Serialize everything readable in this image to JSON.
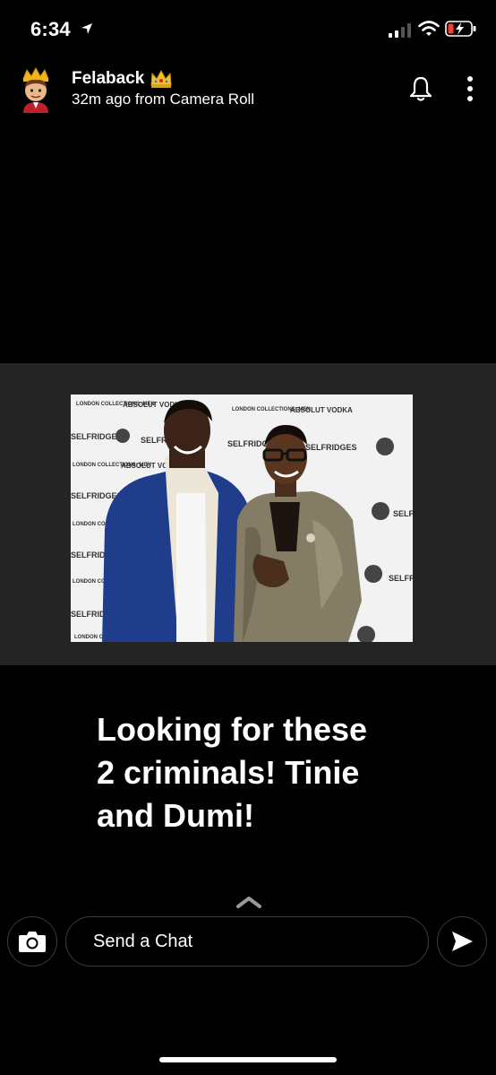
{
  "status_bar": {
    "time": "6:34",
    "icons": [
      "location-arrow-icon",
      "cellular-signal-icon",
      "wifi-icon",
      "battery-charging-icon"
    ]
  },
  "header": {
    "username": "Felaback",
    "crown_emoji": "crown-icon",
    "subtitle": "32m ago from Camera Roll",
    "icons": [
      "bitmoji-avatar",
      "bell-icon",
      "more-vertical-icon"
    ]
  },
  "photo": {
    "backdrop_texts": {
      "london_collections": "LONDON COLLECTIONS: MEN",
      "absolut_vodka": "ABSOLUT VODKA",
      "selfridges": "SELFRIDGES"
    }
  },
  "caption": {
    "text": "Looking for these 2 criminals! Tinie and Dumi!"
  },
  "chat_bar": {
    "placeholder": "Send a Chat",
    "icons": [
      "camera-icon",
      "send-arrow-icon",
      "chevron-up-icon"
    ]
  },
  "colors": {
    "background": "#000000",
    "photo_band": "#242424",
    "border": "#3a3a3a",
    "text": "#ffffff"
  }
}
